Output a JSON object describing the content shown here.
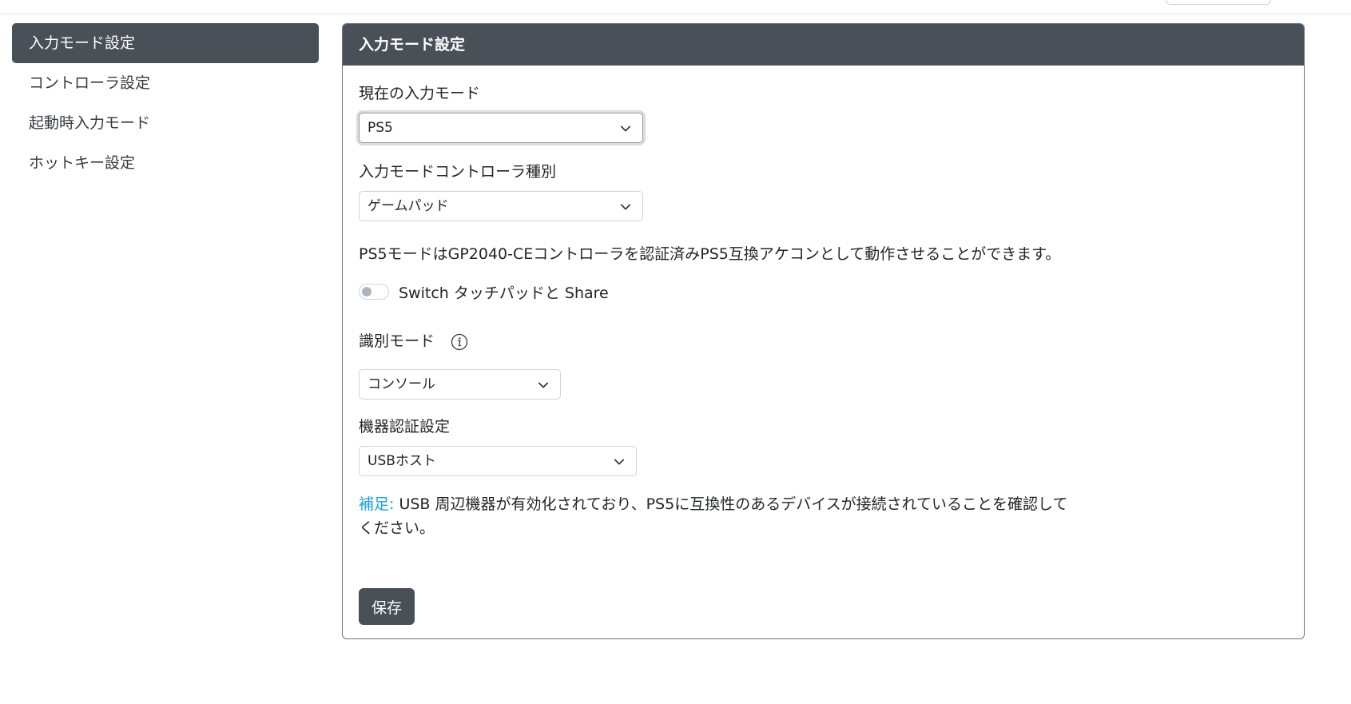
{
  "sidebar": {
    "items": [
      {
        "label": "入力モード設定",
        "active": true
      },
      {
        "label": "コントローラ設定"
      },
      {
        "label": "起動時入力モード"
      },
      {
        "label": "ホットキー設定"
      }
    ]
  },
  "card": {
    "header": "入力モード設定",
    "current_mode": {
      "label": "現在の入力モード",
      "value": "PS5"
    },
    "controller_type": {
      "label": "入力モードコントローラ種別",
      "value": "ゲームパッド"
    },
    "description": "PS5モードはGP2040-CEコントローラを認証済みPS5互換アケコンとして動作させることができます。",
    "toggle": {
      "label": "Switch タッチパッドと Share",
      "on": false
    },
    "identification": {
      "label": "識別モード",
      "value": "コンソール",
      "info_icon": "info-icon"
    },
    "auth": {
      "label": "機器認証設定",
      "value": "USBホスト"
    },
    "note": {
      "prefix": "補足:",
      "text": " USB 周辺機器が有効化されており、PS5に互換性のあるデバイスが接続されていることを確認してください。"
    },
    "save_label": "保存"
  },
  "colors": {
    "header_bg": "#495057",
    "active_nav": "#495057",
    "note_prefix": "#17a2d8",
    "button_bg": "#495057"
  }
}
